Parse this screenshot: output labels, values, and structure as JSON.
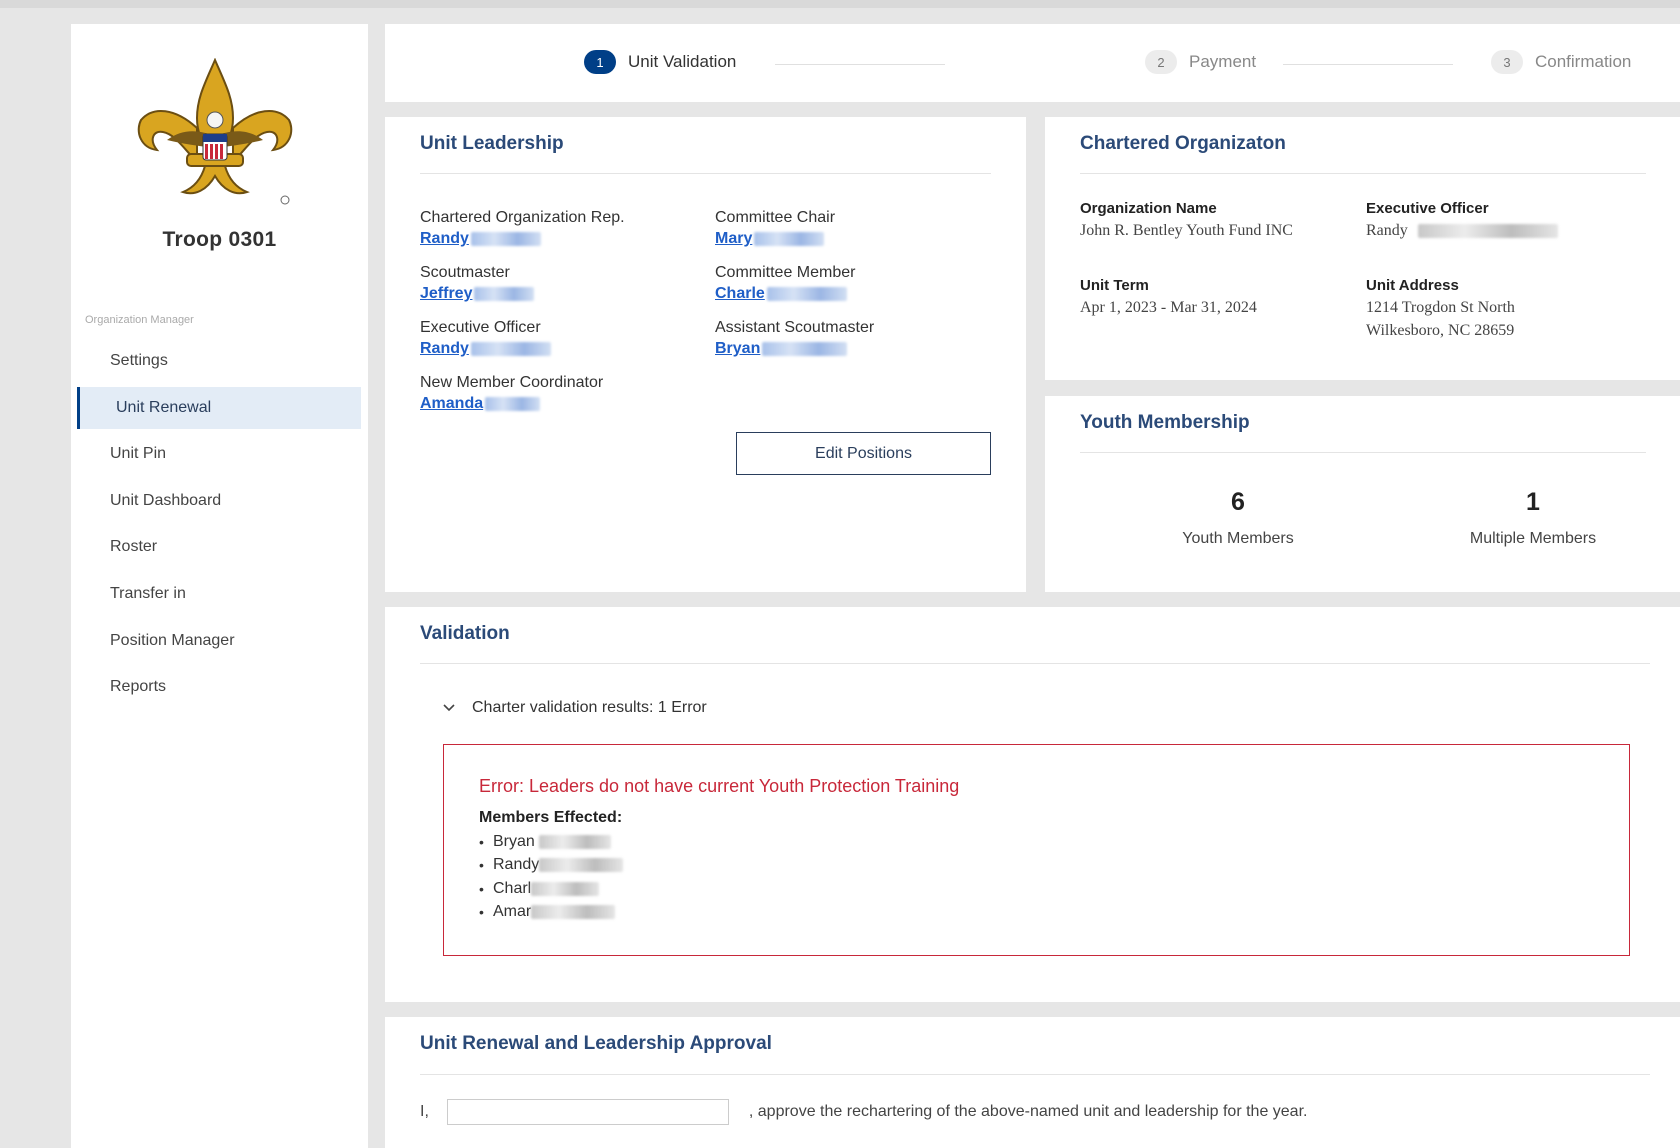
{
  "sidebar": {
    "unit_name": "Troop 0301",
    "section_label": "Organization Manager",
    "items": [
      {
        "label": "Settings",
        "active": false
      },
      {
        "label": "Unit Renewal",
        "active": true
      },
      {
        "label": "Unit Pin",
        "active": false
      },
      {
        "label": "Unit Dashboard",
        "active": false
      },
      {
        "label": "Roster",
        "active": false
      },
      {
        "label": "Transfer in",
        "active": false
      },
      {
        "label": "Position Manager",
        "active": false
      },
      {
        "label": "Reports",
        "active": false
      }
    ]
  },
  "stepper": {
    "steps": [
      {
        "num": "1",
        "label": "Unit Validation",
        "active": true
      },
      {
        "num": "2",
        "label": "Payment",
        "active": false
      },
      {
        "num": "3",
        "label": "Confirmation",
        "active": false
      }
    ]
  },
  "leadership": {
    "title": "Unit Leadership",
    "positions": [
      {
        "position": "Chartered Organization Rep.",
        "name": "Randy"
      },
      {
        "position": "Committee Chair",
        "name": "Mary"
      },
      {
        "position": "Scoutmaster",
        "name": "Jeffrey"
      },
      {
        "position": "Committee Member",
        "name": "Charle"
      },
      {
        "position": "Executive Officer",
        "name": "Randy"
      },
      {
        "position": "Assistant Scoutmaster",
        "name": "Bryan"
      },
      {
        "position": "New Member Coordinator",
        "name": "Amanda"
      }
    ],
    "edit_button": "Edit Positions"
  },
  "org": {
    "title": "Chartered Organizaton",
    "name_label": "Organization Name",
    "name_value": "John R. Bentley Youth Fund INC",
    "exec_label": "Executive Officer",
    "exec_value": "Randy",
    "term_label": "Unit Term",
    "term_value": "Apr 1, 2023 - Mar 31, 2024",
    "address_label": "Unit Address",
    "address_line1": "1214 Trogdon St North",
    "address_line2": "Wilkesboro, NC 28659"
  },
  "youth": {
    "title": "Youth Membership",
    "youth_count": "6",
    "youth_label": "Youth Members",
    "multiple_count": "1",
    "multiple_label": "Multiple Members"
  },
  "validation": {
    "title": "Validation",
    "results_text": "Charter validation results: 1 Error",
    "error_title": "Error: Leaders do not have current Youth Protection Training",
    "effected_label": "Members Effected:",
    "members": [
      "Bryan",
      "Randy",
      "Charl",
      "Amar"
    ]
  },
  "approval": {
    "title": "Unit Renewal and Leadership Approval",
    "prefix": "I,",
    "suffix": ", approve the rechartering of the above-named unit and leadership for the year.",
    "input_value": ""
  },
  "colors": {
    "brand": "#003f87",
    "link": "#1f5ec7",
    "heading": "#2b4a78",
    "error": "#c8283a",
    "active_nav_bg": "#e3ecf6"
  }
}
